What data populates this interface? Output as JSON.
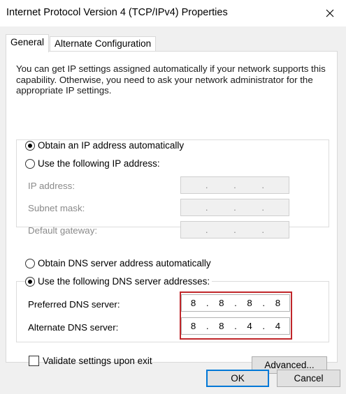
{
  "window": {
    "title": "Internet Protocol Version 4 (TCP/IPv4) Properties"
  },
  "tabs": [
    {
      "label": "General",
      "active": true
    },
    {
      "label": "Alternate Configuration",
      "active": false
    }
  ],
  "general": {
    "intro": "You can get IP settings assigned automatically if your network supports this capability. Otherwise, you need to ask your network administrator for the appropriate IP settings.",
    "ip_mode": {
      "auto_label": "Obtain an IP address automatically",
      "manual_label": "Use the following IP address:",
      "selected": "auto"
    },
    "ip_fields": [
      {
        "label": "IP address:",
        "value": [
          "",
          "",
          "",
          ""
        ],
        "enabled": false
      },
      {
        "label": "Subnet mask:",
        "value": [
          "",
          "",
          "",
          ""
        ],
        "enabled": false
      },
      {
        "label": "Default gateway:",
        "value": [
          "",
          "",
          "",
          ""
        ],
        "enabled": false
      }
    ],
    "dns_mode": {
      "auto_label": "Obtain DNS server address automatically",
      "manual_label": "Use the following DNS server addresses:",
      "selected": "manual"
    },
    "dns_fields": [
      {
        "label": "Preferred DNS server:",
        "value": [
          "8",
          "8",
          "8",
          "8"
        ],
        "enabled": true
      },
      {
        "label": "Alternate DNS server:",
        "value": [
          "8",
          "8",
          "4",
          "4"
        ],
        "enabled": true
      }
    ],
    "validate": {
      "label": "Validate settings upon exit",
      "checked": false
    },
    "advanced_label": "Advanced..."
  },
  "footer": {
    "ok_label": "OK",
    "cancel_label": "Cancel"
  },
  "colors": {
    "highlight": "#c0262a",
    "default_button_border": "#0078d7"
  }
}
